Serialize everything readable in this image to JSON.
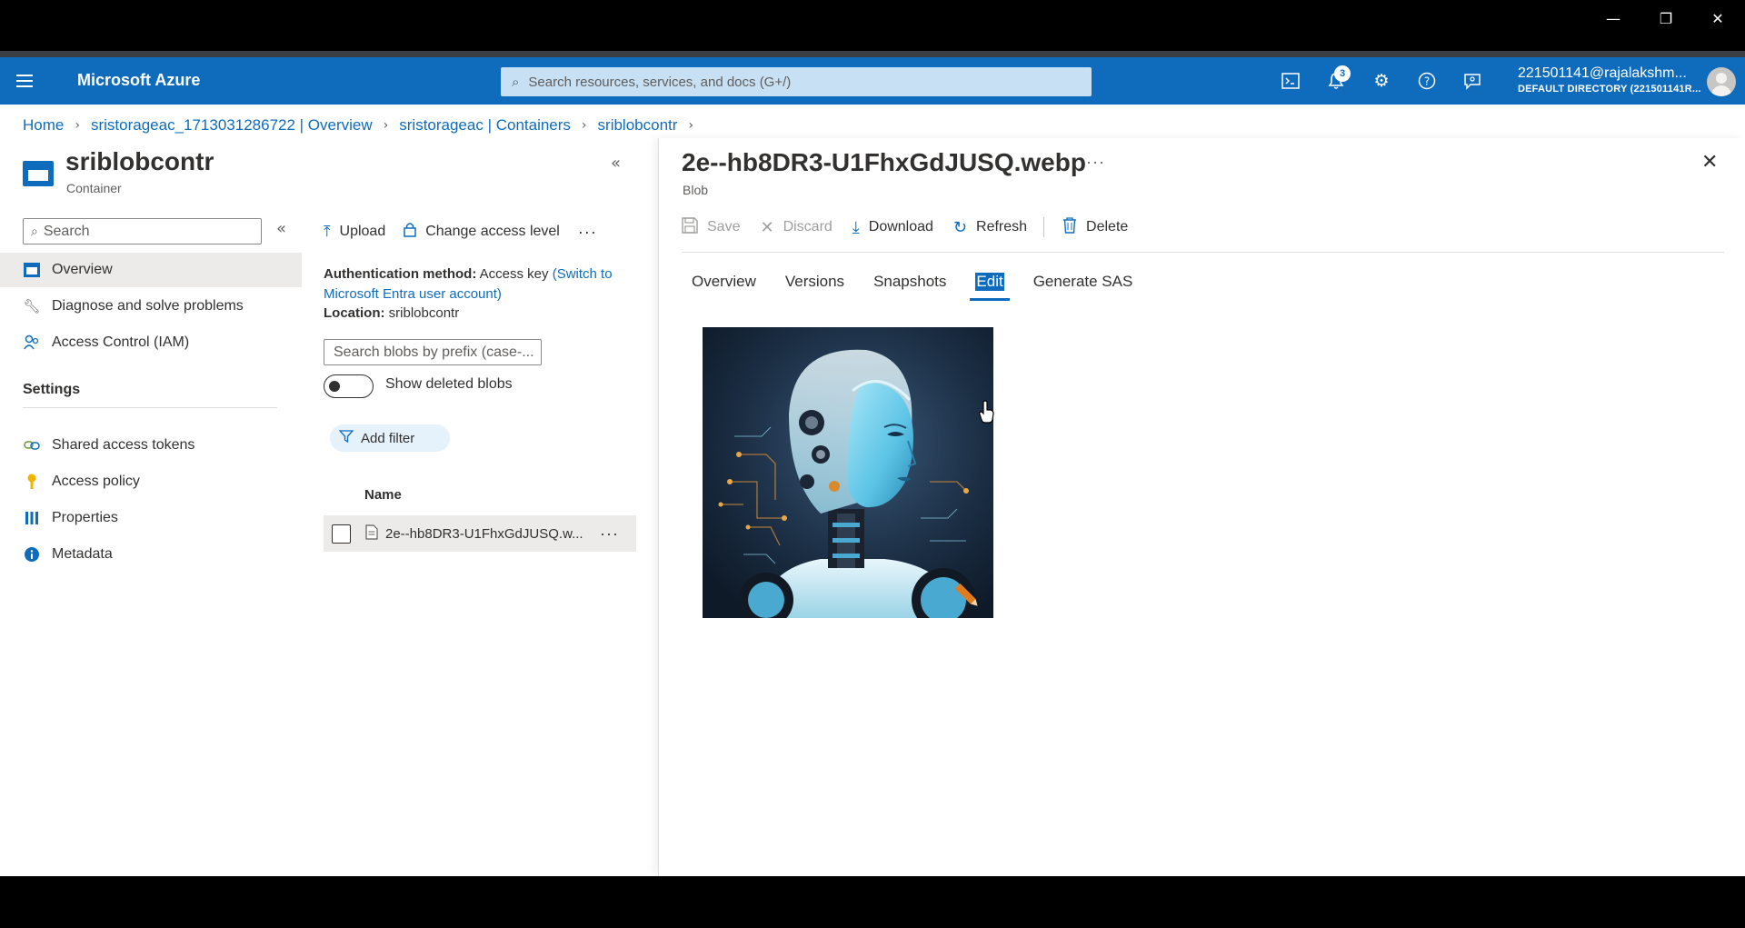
{
  "window": {
    "minimize": "—",
    "restore": "❐",
    "close": "✕"
  },
  "topbar": {
    "brand": "Microsoft Azure",
    "search_placeholder": "Search resources, services, and docs (G+/)",
    "notification_count": "3",
    "user": "221501141@rajalakshm...",
    "directory": "DEFAULT DIRECTORY (221501141R..."
  },
  "breadcrumb": [
    "Home",
    "sristorageac_1713031286722 | Overview",
    "sristorageac | Containers",
    "sriblobcontr"
  ],
  "resource": {
    "title": "sriblobcontr",
    "subtitle": "Container"
  },
  "nav": {
    "search_placeholder": "Search",
    "items": [
      "Overview",
      "Diagnose and solve problems",
      "Access Control (IAM)"
    ],
    "settings_header": "Settings",
    "settings_items": [
      "Shared access tokens",
      "Access policy",
      "Properties",
      "Metadata"
    ]
  },
  "container": {
    "toolbar": {
      "upload": "Upload",
      "change_access": "Change access level",
      "more": "···"
    },
    "auth_label": "Authentication method:",
    "auth_value": "Access key",
    "auth_link": "(Switch to Microsoft Entra user account)",
    "location_label": "Location:",
    "location_value": "sriblobcontr",
    "blob_search_placeholder": "Search blobs by prefix (case-...",
    "show_deleted": "Show deleted blobs",
    "add_filter": "Add filter",
    "column_name": "Name",
    "blobs": [
      "2e--hb8DR3-U1FhxGdJUSQ.w..."
    ]
  },
  "blade": {
    "title": "2e--hb8DR3-U1FhxGdJUSQ.webp",
    "subtitle": "Blob",
    "toolbar": {
      "save": "Save",
      "discard": "Discard",
      "download": "Download",
      "refresh": "Refresh",
      "delete": "Delete"
    },
    "tabs": [
      "Overview",
      "Versions",
      "Snapshots",
      "Edit",
      "Generate SAS"
    ],
    "selected_tab": "Edit"
  },
  "colors": {
    "accent": "#0f6cbd",
    "topbar": "#0f6cbd"
  }
}
